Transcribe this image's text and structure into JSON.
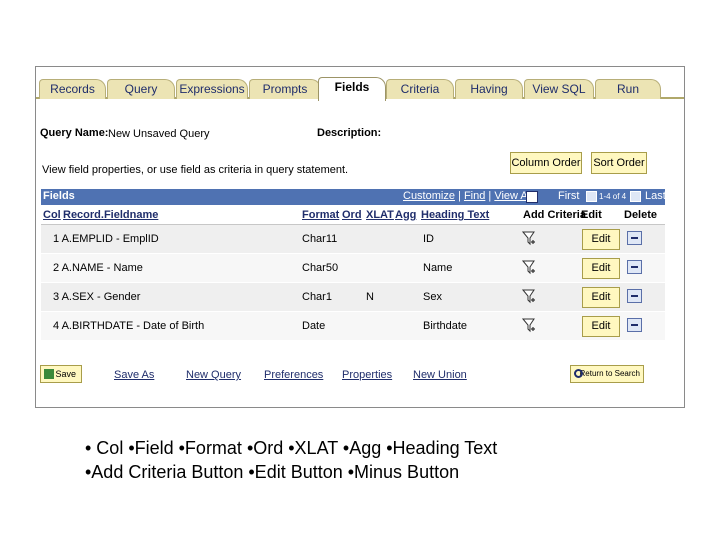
{
  "tabs": [
    "Records",
    "Query",
    "Expressions",
    "Prompts",
    "Fields",
    "Criteria",
    "Having",
    "View SQL",
    "Run"
  ],
  "active_tab": "Fields",
  "query_name_label": "Query Name:",
  "query_name_value": "New Unsaved Query",
  "description_label": "Description:",
  "instructions": "View field properties, or use field as criteria in query statement.",
  "column_order_button": "Column Order",
  "sort_order_button": "Sort Order",
  "grid": {
    "title": "Fields",
    "customize": "Customize",
    "find": "Find",
    "view_all": "View All",
    "first": "First",
    "range": "1-4 of 4",
    "last": "Last",
    "columns": {
      "col": "Col",
      "record_fieldname": "Record.Fieldname",
      "format": "Format",
      "ord": "Ord",
      "xlat": "XLAT",
      "agg": "Agg",
      "heading_text": "Heading Text",
      "add_criteria": "Add Criteria",
      "edit": "Edit",
      "delete": "Delete"
    },
    "rows": [
      {
        "field": "1 A.EMPLID - EmplID",
        "format": "Char11",
        "ord": "",
        "xlat": "",
        "agg": "",
        "heading": "ID",
        "edit": "Edit"
      },
      {
        "field": "2 A.NAME - Name",
        "format": "Char50",
        "ord": "",
        "xlat": "",
        "agg": "",
        "heading": "Name",
        "edit": "Edit"
      },
      {
        "field": "3 A.SEX - Gender",
        "format": "Char1",
        "ord": "",
        "xlat": "N",
        "agg": "",
        "heading": "Sex",
        "edit": "Edit"
      },
      {
        "field": "4 A.BIRTHDATE - Date of Birth",
        "format": "Date",
        "ord": "",
        "xlat": "",
        "agg": "",
        "heading": "Birthdate",
        "edit": "Edit"
      }
    ]
  },
  "footer": {
    "save": "Save",
    "save_as": "Save As",
    "new_query": "New Query",
    "preferences": "Preferences",
    "properties": "Properties",
    "new_union": "New Union",
    "return_to_search": "Return to Search"
  },
  "bullet_line1": "• Col  •Field  •Format  •Ord  •XLAT  •Agg  •Heading Text",
  "bullet_line2": "•Add Criteria Button  •Edit Button  •Minus Button",
  "colors": {
    "grid_header": "#4f72b2",
    "tab_bg": "#ece4b4",
    "button_bg": "#fff8c0"
  }
}
